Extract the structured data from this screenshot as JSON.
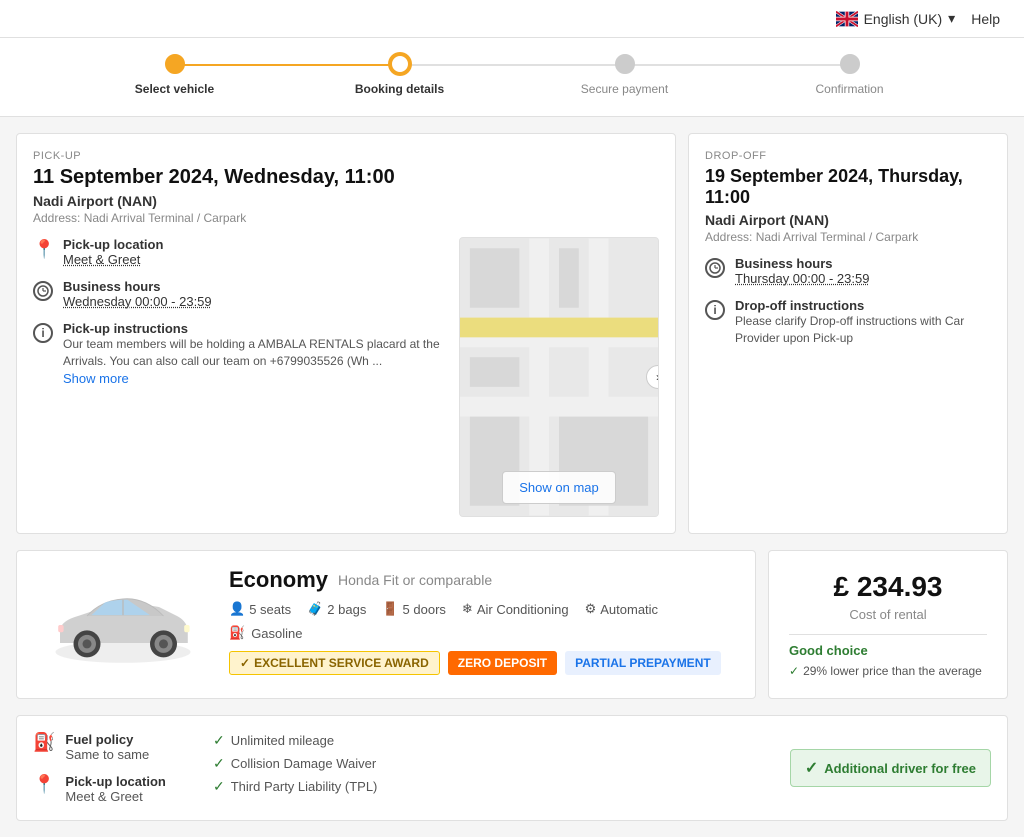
{
  "topbar": {
    "language": "English (UK)",
    "help_label": "Help",
    "chevron": "▾"
  },
  "progress": {
    "steps": [
      {
        "label": "Select vehicle",
        "state": "active-filled"
      },
      {
        "label": "Booking details",
        "state": "active-outline"
      },
      {
        "label": "Secure payment",
        "state": "inactive"
      },
      {
        "label": "Confirmation",
        "state": "inactive"
      }
    ]
  },
  "pickup": {
    "section_label": "PICK-UP",
    "date_time": "11 September 2024, Wednesday, 11:00",
    "location_name": "Nadi Airport (NAN)",
    "address": "Address: Nadi Arrival Terminal / Carpark",
    "pickup_location_label": "Pick-up location",
    "pickup_location_value": "Meet & Greet",
    "business_hours_label": "Business hours",
    "business_hours_value": "Wednesday 00:00 - 23:59",
    "instructions_label": "Pick-up instructions",
    "instructions_text": "Our team members will be holding a AMBALA RENTALS placard at the Arrivals. You can also call our team on +6799035526 (Wh ...",
    "show_more_label": "Show more",
    "show_on_map_label": "Show on map"
  },
  "dropoff": {
    "section_label": "DROP-OFF",
    "date_time": "19 September 2024, Thursday, 11:00",
    "location_name": "Nadi Airport (NAN)",
    "address": "Address: Nadi Arrival Terminal / Carpark",
    "business_hours_label": "Business hours",
    "business_hours_value": "Thursday 00:00 - 23:59",
    "instructions_label": "Drop-off instructions",
    "instructions_text": "Please clarify Drop-off instructions with Car Provider upon Pick-up"
  },
  "vehicle": {
    "class": "Economy",
    "model": "Honda Fit or comparable",
    "specs": {
      "seats": "5 seats",
      "bags": "2 bags",
      "doors": "5 doors",
      "ac": "Air Conditioning",
      "transmission": "Automatic"
    },
    "fuel_type": "Gasoline",
    "badges": {
      "award": "EXCELLENT SERVICE AWARD",
      "deposit": "ZERO DEPOSIT",
      "payment": "PARTIAL PREPAYMENT"
    },
    "features": [
      "Unlimited mileage",
      "Collision Damage Waiver",
      "Third Party Liability (TPL)"
    ],
    "additional_driver": "Additional driver for free"
  },
  "price": {
    "amount": "£ 234.93",
    "label": "Cost of rental",
    "good_choice": "Good choice",
    "lower_price_text": "29% lower price than the average"
  },
  "bottom_vehicle": {
    "fuel_policy_label": "Fuel policy",
    "fuel_policy_value": "Same to same",
    "pickup_location_label": "Pick-up location",
    "pickup_location_value": "Meet & Greet"
  }
}
